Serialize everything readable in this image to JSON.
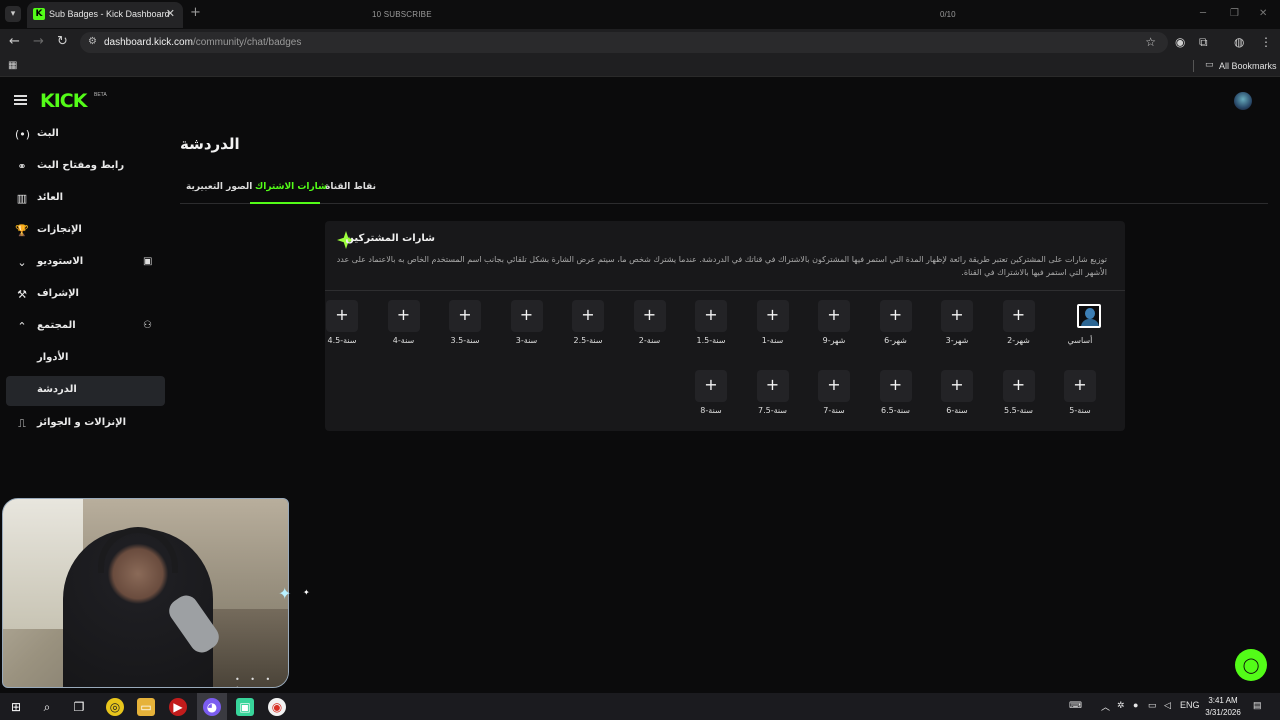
{
  "browser": {
    "tab_title": "Sub Badges - Kick Dashboard",
    "tab_favicon": "K",
    "overlay_subscribe": "10 SUBSCRIBE",
    "overlay_count": "0/10",
    "url_host": "dashboard.kick.com",
    "url_path": "/community/chat/badges",
    "bookmarks_label": "All Bookmarks"
  },
  "app": {
    "logo": "KICK",
    "logo_badge": "BETA",
    "brand_color": "#53fc18"
  },
  "sidebar": {
    "items": [
      {
        "label": "البث",
        "icon": "live-icon",
        "glyph": "(•)"
      },
      {
        "label": "رابط ومفتاح البث",
        "icon": "link-icon",
        "glyph": "⚭"
      },
      {
        "label": "العائد",
        "icon": "revenue-icon",
        "glyph": "▥"
      },
      {
        "label": "الإنجازات",
        "icon": "trophy-icon",
        "glyph": "🏆"
      },
      {
        "label": "الاستوديو",
        "icon": "chevron-down-icon",
        "glyph": "⌄",
        "extra": "▣"
      },
      {
        "label": "الإشراف",
        "icon": "moderation-icon",
        "glyph": "⚒"
      },
      {
        "label": "المجتمع",
        "icon": "chevron-up-icon",
        "glyph": "⌃",
        "extra": "⚇"
      },
      {
        "label": "الأدوار",
        "icon": "",
        "glyph": ""
      },
      {
        "label": "الدردشة",
        "icon": "",
        "glyph": ""
      },
      {
        "label": "الإنزالات و الجوائز",
        "icon": "drops-icon",
        "glyph": "⎍"
      }
    ]
  },
  "page": {
    "title": "الدردشة",
    "tabs": [
      {
        "label": "نقاط القناة"
      },
      {
        "label": "شارات الاشتراك"
      },
      {
        "label": "الصور التعبيرية"
      }
    ]
  },
  "card": {
    "title": "شارات المشتركين",
    "description": "توزيع شارات على المشتركين تعتبر طريقة رائعة لإظهار المدة التي استمر فيها المشتركون بالاشتراك في قناتك في الدردشة. عندما يشترك شخص ما، سيتم عرض الشارة بشكل تلقائي بجانب اسم المستخدم الخاص به بالاعتماد على عدد الأشهر التي استمر فيها بالاشتراك في القناة.",
    "badges": [
      {
        "label": "أساسي",
        "has_image": true
      },
      {
        "label": "شهر-2"
      },
      {
        "label": "شهر-3"
      },
      {
        "label": "شهر-6"
      },
      {
        "label": "شهر-9"
      },
      {
        "label": "سنة-1"
      },
      {
        "label": "سنة-1.5"
      },
      {
        "label": "سنة-2"
      },
      {
        "label": "سنة-2.5"
      },
      {
        "label": "سنة-3"
      },
      {
        "label": "سنة-3.5"
      },
      {
        "label": "سنة-4"
      },
      {
        "label": "سنة-4.5"
      },
      {
        "label": "سنة-5"
      },
      {
        "label": "سنة-5.5"
      },
      {
        "label": "سنة-6"
      },
      {
        "label": "سنة-6.5"
      },
      {
        "label": "سنة-7"
      },
      {
        "label": "سنة-7.5"
      },
      {
        "label": "سنة-8"
      }
    ],
    "add_glyph": "+"
  },
  "taskbar": {
    "lang": "ENG",
    "time": "3:41 AM",
    "date": "3/31/2026"
  }
}
